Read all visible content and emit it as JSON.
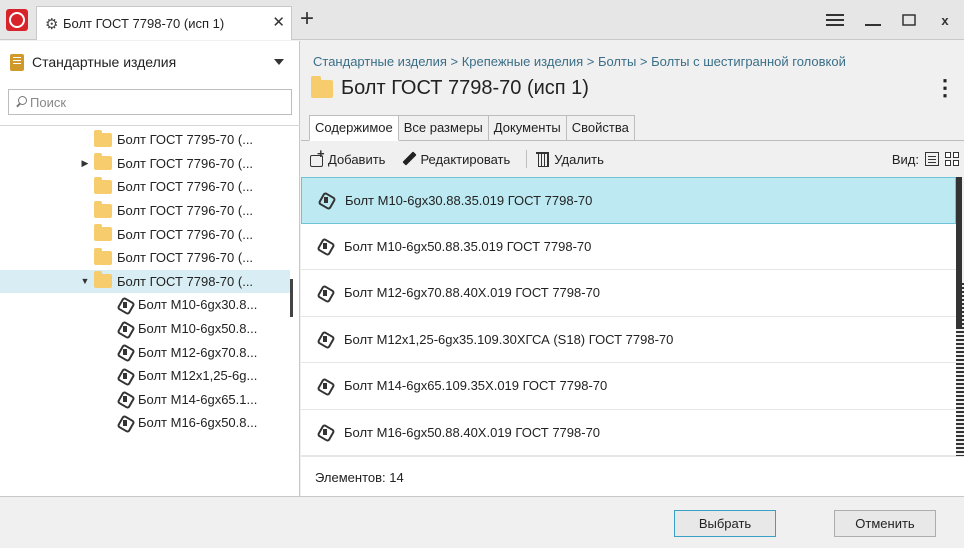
{
  "window": {
    "tab_title": "Болт ГОСТ 7798-70 (исп 1)"
  },
  "library": {
    "selected": "Стандартные изделия"
  },
  "search": {
    "placeholder": "Поиск"
  },
  "tree": [
    {
      "label": "Болт ГОСТ 7795-70 (...",
      "type": "folder",
      "arrow": ""
    },
    {
      "label": "Болт ГОСТ 7796-70 (...",
      "type": "folder",
      "arrow": "▶"
    },
    {
      "label": "Болт ГОСТ 7796-70 (...",
      "type": "folder",
      "arrow": ""
    },
    {
      "label": "Болт ГОСТ 7796-70 (...",
      "type": "folder",
      "arrow": ""
    },
    {
      "label": "Болт ГОСТ 7796-70 (...",
      "type": "folder",
      "arrow": ""
    },
    {
      "label": "Болт ГОСТ 7796-70 (...",
      "type": "folder",
      "arrow": ""
    },
    {
      "label": "Болт ГОСТ 7798-70 (...",
      "type": "folder",
      "arrow": "▼"
    },
    {
      "label": "Болт М10-6gх30.8...",
      "type": "item"
    },
    {
      "label": "Болт М10-6gх50.8...",
      "type": "item"
    },
    {
      "label": "Болт М12-6gх70.8...",
      "type": "item"
    },
    {
      "label": "Болт М12х1,25-6g...",
      "type": "item"
    },
    {
      "label": "Болт М14-6gх65.1...",
      "type": "item"
    },
    {
      "label": "Болт М16-6gх50.8...",
      "type": "item"
    }
  ],
  "main": {
    "breadcrumb": "Стандартные изделия > Крепежные изделия > Болты > Болты с шестигранной головкой",
    "title": "Болт ГОСТ 7798-70 (исп 1)",
    "tabs": [
      "Содержимое",
      "Все размеры",
      "Документы",
      "Свойства"
    ],
    "toolbar": {
      "add": "Добавить",
      "edit": "Редактировать",
      "delete": "Удалить",
      "view_label": "Вид:"
    },
    "items": [
      "Болт М10-6gх30.88.35.019 ГОСТ 7798-70",
      "Болт М10-6gх50.88.35.019 ГОСТ 7798-70",
      "Болт М12-6gх70.88.40Х.019 ГОСТ 7798-70",
      "Болт М12х1,25-6gх35.109.30ХГСА (S18) ГОСТ 7798-70",
      "Болт М14-6gх65.109.35Х.019 ГОСТ 7798-70",
      "Болт М16-6gх50.88.40Х.019 ГОСТ 7798-70"
    ],
    "count_text": "Элементов: 14"
  },
  "footer": {
    "select": "Выбрать",
    "cancel": "Отменить"
  },
  "colors": {
    "accent": "#d8232a",
    "selection": "#bdeaf2",
    "tree_selection": "#d9eef4",
    "breadcrumb": "#3a6f88"
  }
}
